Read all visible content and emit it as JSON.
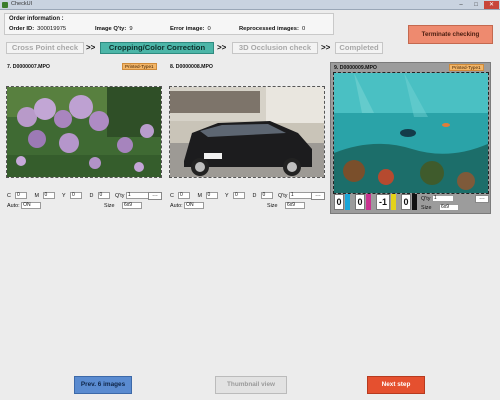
{
  "window": {
    "title": "CheckUI"
  },
  "order": {
    "header": "Order information :",
    "order_id_label": "Order ID:",
    "order_id": "300019975",
    "image_qty_label": "Image Q'ty:",
    "image_qty": "9",
    "error_label": "Error image:",
    "error_count": "0",
    "reprocessed_label": "Reprocessed images:",
    "reprocessed_count": "0"
  },
  "terminate_label": "Terminate checking",
  "steps": [
    {
      "label": "Cross Point check",
      "active": false
    },
    {
      "label": "Cropping/Color Correction",
      "active": true
    },
    {
      "label": "3D Occlusion check",
      "active": false
    },
    {
      "label": "Completed",
      "active": false
    }
  ],
  "step_separator": ">>",
  "adjust_labels": {
    "c": "C",
    "m": "M",
    "y": "Y",
    "d": "D",
    "qty": "Q'ty",
    "auto": "Auto:",
    "size": "Size"
  },
  "images": [
    {
      "filename": "7. D0000007.MPO",
      "badge": "Printed-Type1",
      "c": "0",
      "m": "0",
      "y": "0",
      "d": "0",
      "qty": "1",
      "auto": "ON",
      "size": "6x9",
      "selected": false
    },
    {
      "filename": "8. D0000008.MPO",
      "badge": "",
      "c": "0",
      "m": "0",
      "y": "0",
      "d": "0",
      "qty": "1",
      "auto": "ON",
      "size": "6x9",
      "selected": false
    },
    {
      "filename": "9. D0000009.MPO",
      "badge": "Printed-Type1",
      "c": "0",
      "m": "0",
      "y": "-1",
      "d": "0",
      "qty": "1",
      "auto": "ON",
      "size": "6x9",
      "selected": true
    }
  ],
  "colors": {
    "cyan": "#1aa6d8",
    "magenta": "#c9328f",
    "yellow": "#e3d21a",
    "black": "#111111"
  },
  "buttons": {
    "prev": "Prev. 6 images",
    "thumbnail": "Thumbnail view",
    "next": "Next step"
  }
}
